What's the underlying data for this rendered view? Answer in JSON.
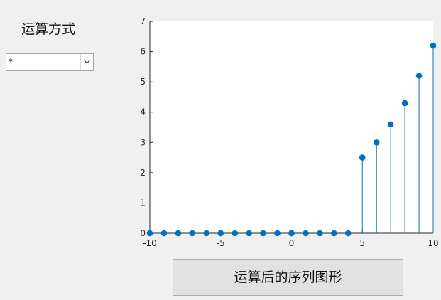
{
  "controls": {
    "operation_label": "运算方式",
    "operation_value": "*",
    "show_button_label": "运算后的序列图形"
  },
  "colors": {
    "stem": "#0072bd",
    "axes": "#262626"
  },
  "chart_data": {
    "type": "stem",
    "x": [
      -10,
      -9,
      -8,
      -7,
      -6,
      -5,
      -4,
      -3,
      -2,
      -1,
      0,
      1,
      2,
      3,
      4,
      5,
      6,
      7,
      8,
      9,
      10
    ],
    "values": [
      0,
      0,
      0,
      0,
      0,
      0,
      0,
      0,
      0,
      0,
      0,
      0,
      0,
      0,
      0,
      2.5,
      3.0,
      3.6,
      4.3,
      5.2,
      6.2
    ],
    "xlim": [
      -10,
      10
    ],
    "ylim": [
      0,
      7
    ],
    "xticks": [
      -10,
      -5,
      0,
      5,
      10
    ],
    "yticks": [
      0,
      1,
      2,
      3,
      4,
      5,
      6,
      7
    ],
    "grid": false,
    "legend": "none"
  }
}
